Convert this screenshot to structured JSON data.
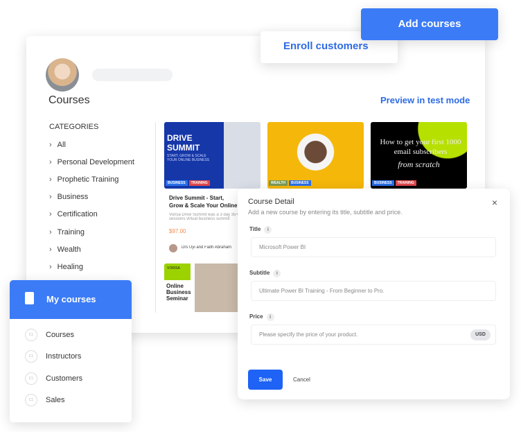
{
  "header": {
    "add_courses": "Add courses",
    "enroll_customers": "Enroll customers"
  },
  "main": {
    "title": "Courses",
    "preview": "Preview in test mode",
    "categories_heading": "CATEGORIES",
    "categories": [
      "All",
      "Personal Development",
      "Prophetic Training",
      "Business",
      "Certification",
      "Training",
      "Wealth",
      "Healing"
    ],
    "cards": [
      {
        "image_text": "DRIVE SUMMIT",
        "image_sub": "START, GROW & SCALE YOUR ONLINE BUSINESS",
        "tags": [
          "BUSINESS",
          "TRAINING"
        ],
        "title": "Drive Summit - Start, Grow & Scale Your Online Business",
        "desc": "Vorisa Drive Summit was a 3 day 35+ sessions virtual business summit",
        "price": "$97.00",
        "author": "Drs Uyi and Faith Abraham"
      },
      {
        "tags": [
          "WEALTH",
          "BUSINESS"
        ]
      },
      {
        "image_text": "How to get your first 1000 email subscribers",
        "image_script": "from scratch",
        "tags": [
          "BUSINESS",
          "TRAINING"
        ]
      },
      {
        "image_text": "Online Business Seminar",
        "brand": "VORISA"
      }
    ]
  },
  "menu": {
    "title": "My courses",
    "items": [
      "Courses",
      "Instructors",
      "Customers",
      "Sales"
    ],
    "badge": "C1"
  },
  "modal": {
    "title": "Course Detail",
    "subtitle": "Add a new course by entering its title, subtitle and price.",
    "title_label": "Title",
    "title_value": "Microsoft Power BI",
    "subtitle_label": "Subtitle",
    "subtitle_value": "Ultimate Power BI Training - From Beginner to Pro.",
    "price_label": "Price",
    "price_placeholder": "Please specify the price of your product.",
    "currency": "USD",
    "save": "Save",
    "cancel": "Cancel",
    "close": "×",
    "info": "i"
  },
  "colors": {
    "accent": "#3b7bf6",
    "save": "#1e63f5",
    "price": "#f08a4b"
  }
}
